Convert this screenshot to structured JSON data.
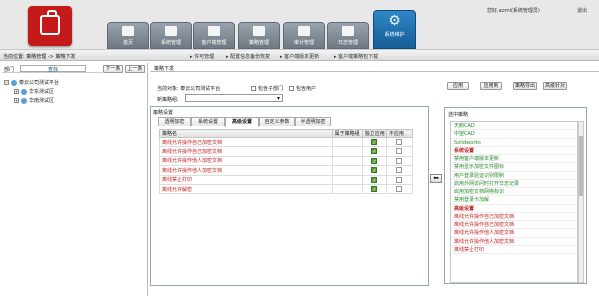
{
  "nav": [
    "首页",
    "系统管理",
    "客户端管理",
    "策略管理",
    "审计管理",
    "日志管理",
    "系统维护"
  ],
  "user": {
    "greeting": "您好,aomi(系统管理员)",
    "logout": "退出"
  },
  "crumb": "当前位置: 策略管理 -> 策略下发",
  "quick_links": [
    "许可管理",
    "配置信息备份恢复",
    "客户端版本更新",
    "客户端策略包下载"
  ],
  "left": {
    "title": "部门",
    "find": "查找",
    "prev": "下一条",
    "next": "上一条",
    "tree": [
      {
        "label": "泰云公司测试平台",
        "level": 0
      },
      {
        "label": "华东测试区",
        "level": 1
      },
      {
        "label": "华南测试区",
        "level": 1
      }
    ]
  },
  "tab": "策略下发",
  "target": {
    "label": "当前对象: 泰云公司测试平台",
    "opt1": "包含子部门",
    "opt2": "包含用户"
  },
  "strategy": {
    "label": "新策略组:"
  },
  "buttons": [
    "应用",
    "应用到",
    "策略导出",
    "高级针对"
  ],
  "settings_title": "策略设置",
  "subtabs": [
    "透明加密",
    "系统设置",
    "高级设置",
    "自定义参数",
    "半透明加密"
  ],
  "grid": {
    "headers": [
      "策略名",
      "属于策略组",
      "独立应用",
      "不应用"
    ],
    "rows": [
      {
        "name": "离线允许操作自己加密文档",
        "group": "",
        "indep": true,
        "not": false
      },
      {
        "name": "离线允许操作自己加密文档",
        "group": "",
        "indep": true,
        "not": false
      },
      {
        "name": "离线允许操作他人加密文档",
        "group": "",
        "indep": true,
        "not": false
      },
      {
        "name": "离线允许操作他人加密文档",
        "group": "",
        "indep": true,
        "not": false
      },
      {
        "name": "离线禁止打印",
        "group": "",
        "indep": true,
        "not": false
      },
      {
        "name": "离线允许解密",
        "group": "",
        "indep": true,
        "not": false
      }
    ]
  },
  "right": {
    "title": "选中策略",
    "items": [
      {
        "text": "天鹅CAD",
        "type": "normal"
      },
      {
        "text": "中望CAD",
        "type": "normal"
      },
      {
        "text": "Solidworks",
        "type": "normal"
      },
      {
        "text": "系统设置",
        "type": "head"
      },
      {
        "text": "禁用客户端版本更新",
        "type": "normal"
      },
      {
        "text": "禁用显示加密文件图标",
        "type": "normal"
      },
      {
        "text": "用户登录验证识别限制",
        "type": "normal"
      },
      {
        "text": "启用外网访问时打开日志记录",
        "type": "normal"
      },
      {
        "text": "启用加密文档网络标识",
        "type": "normal"
      },
      {
        "text": "禁用登录卡加解",
        "type": "normal"
      },
      {
        "text": "高级设置",
        "type": "head"
      },
      {
        "text": "离线允许操作自己加密文档",
        "type": "red"
      },
      {
        "text": "离线允许操作自己加密文档",
        "type": "red"
      },
      {
        "text": "离线允许操作他人加密文档",
        "type": "red"
      },
      {
        "text": "离线允许操作他人加密文档",
        "type": "red"
      },
      {
        "text": "离线禁止打印",
        "type": "red"
      }
    ]
  },
  "arrow": "⬅",
  "icons": {
    "logo": "briefcase-logo",
    "nav_active": "gears-icon"
  }
}
